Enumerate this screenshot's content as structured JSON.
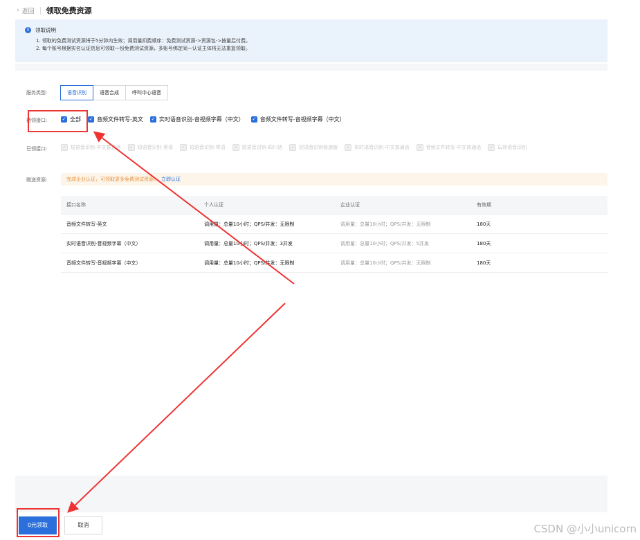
{
  "header": {
    "back_label": "返回",
    "title": "领取免费资源"
  },
  "notice": {
    "title": "领取说明",
    "lines": [
      "1. 领取的免费测试资源将于5分钟内生效；调用量扣费顺序：免费测试资源->资源包->按量后付费。",
      "2. 每个账号根据实名认证信息可领取一份免费测试资源，多账号绑定同一认证主体将无法重复领取。"
    ]
  },
  "form": {
    "service_type_label": "服务类型:",
    "service_tabs": [
      "语音识别",
      "语音合成",
      "呼叫中心语音"
    ],
    "pending_label": "待领接口:",
    "pending_items": [
      "全部",
      "音频文件转写-英文",
      "实时语音识别-音视频字幕（中文）",
      "音频文件转写-音视频字幕（中文）"
    ],
    "claimed_label": "已领接口:",
    "claimed_items": [
      "短语音识别-中文普通话",
      "短语音识别-英语",
      "短语音识别-粤语",
      "短语音识别-四川话",
      "短语音识别极速版",
      "实时语音识别-中文普通话",
      "音频文件转写-中文普通话",
      "玩场语音识别"
    ],
    "gift_label": "赠送资源:",
    "gift_notice": "完成企业认证，可领取更多免费测试资源。",
    "gift_link": "立即认证"
  },
  "table": {
    "headers": [
      "接口名称",
      "个人认证",
      "企业认证",
      "有效期"
    ],
    "rows": [
      [
        "音频文件转写-英文",
        "调用量：总量10小时；QPS/并发：无限制",
        "调用量：总量10小时；QPS/并发：无限制",
        "180天"
      ],
      [
        "实时语音识别-音视频字幕（中文）",
        "调用量：总量10小时；QPS/并发：3并发",
        "调用量：总量10小时；QPS/并发：5并发",
        "180天"
      ],
      [
        "音频文件转写-音视频字幕（中文）",
        "调用量：总量10小时；QPS/并发：无限制",
        "调用量：总量10小时；QPS/并发：无限制",
        "180天"
      ]
    ]
  },
  "footer": {
    "primary_label": "0元领取",
    "cancel_label": "取消"
  },
  "watermark": "CSDN @小小unicorn",
  "colors": {
    "accent": "#2a6fdb",
    "annotation": "#e33333",
    "notice_bg": "#eaf2fb"
  }
}
